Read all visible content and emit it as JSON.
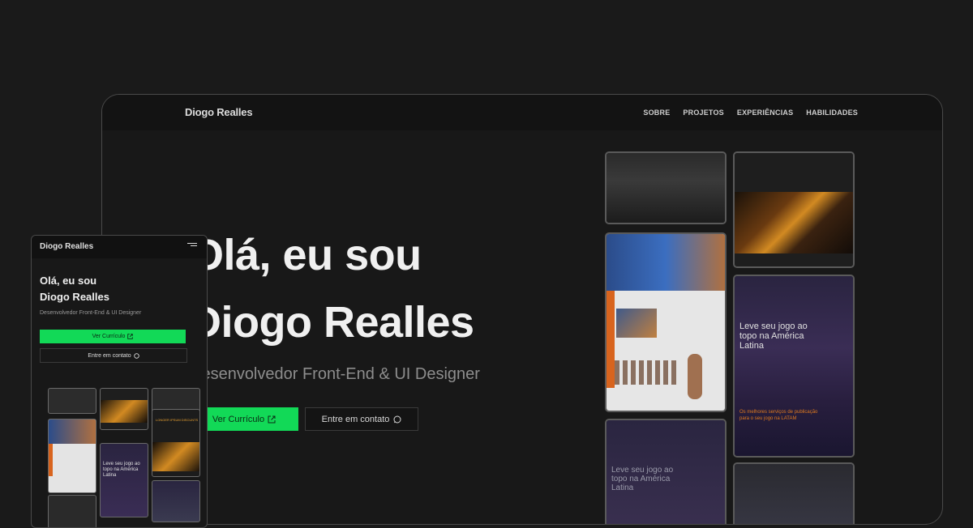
{
  "desktop": {
    "logo": "Diogo Realles",
    "nav": [
      "SOBRE",
      "PROJETOS",
      "EXPERIÊNCIAS",
      "HABILIDADES"
    ],
    "heading_line1": "Olá, eu sou",
    "heading_line2": "Diogo Realles",
    "subtitle": "Desenvolvedor Front-End & UI Designer",
    "cv_button": "Ver Currículo",
    "contact_button": "Entre em contato"
  },
  "showcase": {
    "card_tagline": "Leve seu jogo ao topo na América Latina",
    "card_cta": "Os melhores serviços de publicação para o seu jogo na LATAM"
  },
  "mobile": {
    "logo": "Diogo Realles",
    "heading_line1": "Olá, eu sou",
    "heading_line2": "Diogo Realles",
    "subtitle": "Desenvolvedor Front-End & UI Designer",
    "cv_button": "Ver Currículo",
    "contact_button": "Entre em contato",
    "card_title": "LONGER IPSUM DISCUNTS"
  },
  "colors": {
    "accent": "#12d957",
    "background": "#1a1a1a"
  },
  "icons": {
    "cv": "external-link-icon",
    "contact": "whatsapp-icon",
    "menu": "hamburger-menu-icon"
  }
}
